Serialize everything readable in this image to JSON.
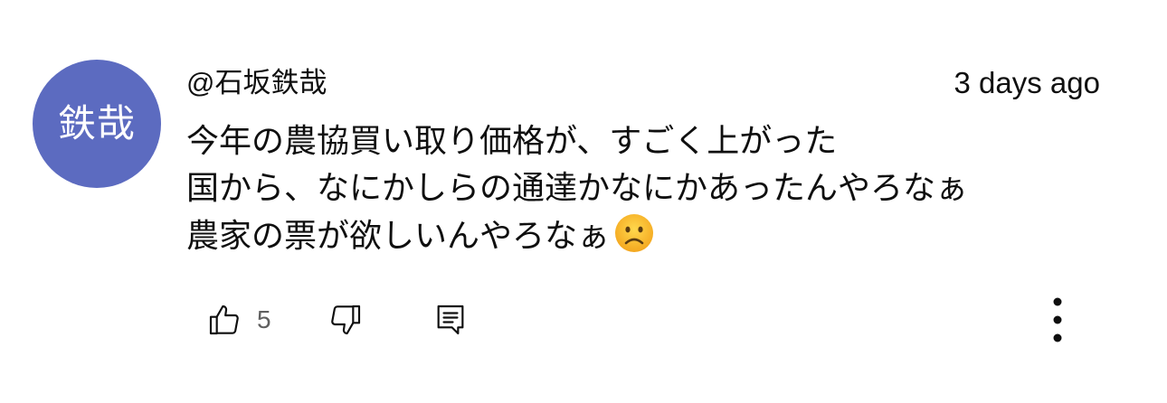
{
  "comment": {
    "avatar_text": "鉄哉",
    "avatar_color": "#5c6bc0",
    "author": "@石坂鉄哉",
    "timestamp": "3 days ago",
    "lines": [
      "今年の農協買い取り価格が、すごく上がった",
      "国から、なにかしらの通達かなにかあったんやろなぁ",
      "農家の票が欲しいんやろなぁ"
    ],
    "emoji": "frowning-face-emoji"
  },
  "actions": {
    "like_icon": "thumbs-up-icon",
    "like_count": "5",
    "dislike_icon": "thumbs-down-icon",
    "reply_icon": "comment-reply-icon",
    "more_icon": "more-vertical-icon"
  }
}
